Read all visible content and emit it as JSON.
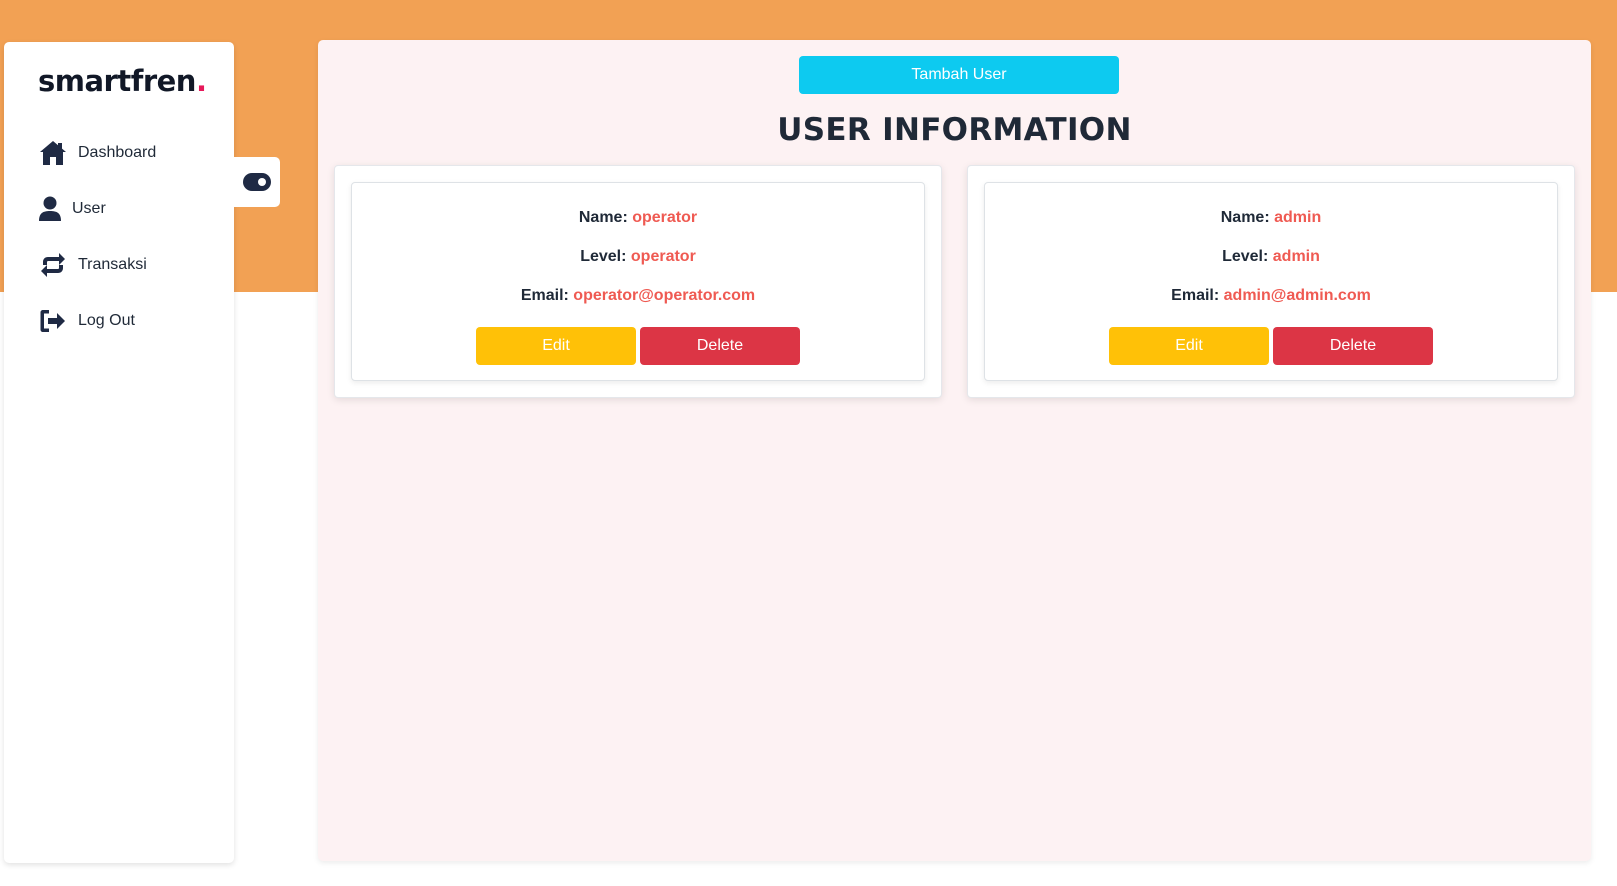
{
  "brand": {
    "logo_text": "smartfren",
    "logo_dot": ".",
    "dot_color": "#e6195a"
  },
  "colors": {
    "top_band": "#f2a154",
    "main_bg": "#fdf2f3",
    "primary_button": "#0dcaf0",
    "edit_button": "#ffc107",
    "delete_button": "#dc3545",
    "value_text": "#ef5a52"
  },
  "sidebar": {
    "items": [
      {
        "label": "Dashboard",
        "icon": "home-icon"
      },
      {
        "label": "User",
        "icon": "user-icon"
      },
      {
        "label": "Transaksi",
        "icon": "repeat-icon"
      },
      {
        "label": "Log Out",
        "icon": "logout-icon"
      }
    ],
    "toggle_icon": "toggle-icon"
  },
  "main": {
    "add_button_label": "Tambah User",
    "title": "USER INFORMATION",
    "users": [
      {
        "name_label": "Name:",
        "name": "operator",
        "level_label": "Level:",
        "level": "operator",
        "email_label": "Email:",
        "email": "operator@operator.com",
        "edit_label": "Edit",
        "delete_label": "Delete"
      },
      {
        "name_label": "Name:",
        "name": "admin",
        "level_label": "Level:",
        "level": "admin",
        "email_label": "Email:",
        "email": "admin@admin.com",
        "edit_label": "Edit",
        "delete_label": "Delete"
      }
    ]
  }
}
